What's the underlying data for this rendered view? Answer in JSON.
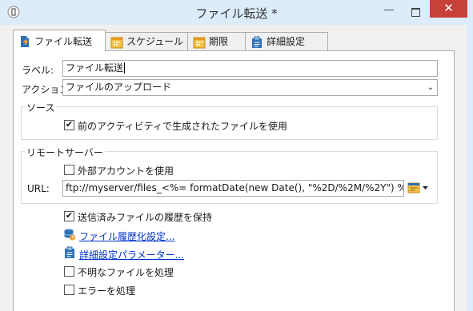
{
  "window": {
    "title": "ファイル転送 *",
    "min_glyph": "—",
    "close_glyph": "✕"
  },
  "tabs": [
    {
      "label": "ファイル転送",
      "icon": "file-upload-icon"
    },
    {
      "label": "スケジュール",
      "icon": "calendar-icon"
    },
    {
      "label": "期限",
      "icon": "calendar-icon"
    },
    {
      "label": "詳細設定",
      "icon": "clipboard-icon"
    }
  ],
  "form": {
    "label_caption": "ラベル:",
    "label_value": "ファイル転送",
    "action_caption": "アクション:",
    "action_value": "ファイルのアップロード",
    "action_arrow": "⌄"
  },
  "source": {
    "group_label": "ソース",
    "use_previous_file_label": "前のアクティビティで生成されたファイルを使用",
    "use_previous_file_checked": true
  },
  "remote": {
    "group_label": "リモートサーバー",
    "external_account_label": "外部アカウントを使用",
    "external_account_checked": false,
    "url_caption": "URL:",
    "url_value": "ftp://myserver/files_<%= formatDate(new Date(), \"%2D/%2M/%2Y\") %"
  },
  "options": {
    "keep_history_label": "送信済みファイルの履歴を保持",
    "keep_history_checked": true,
    "history_settings_link": "ファイル履歴化設定...",
    "advanced_params_link": "詳細設定パラメーター...",
    "unknown_files_label": "不明なファイルを処理",
    "unknown_files_checked": false,
    "errors_label": "エラーを処理",
    "errors_checked": false
  },
  "check_glyph": "✔",
  "colors": {
    "titlebar": "#dcecfb",
    "close": "#c7403a",
    "link": "#0033cc"
  }
}
